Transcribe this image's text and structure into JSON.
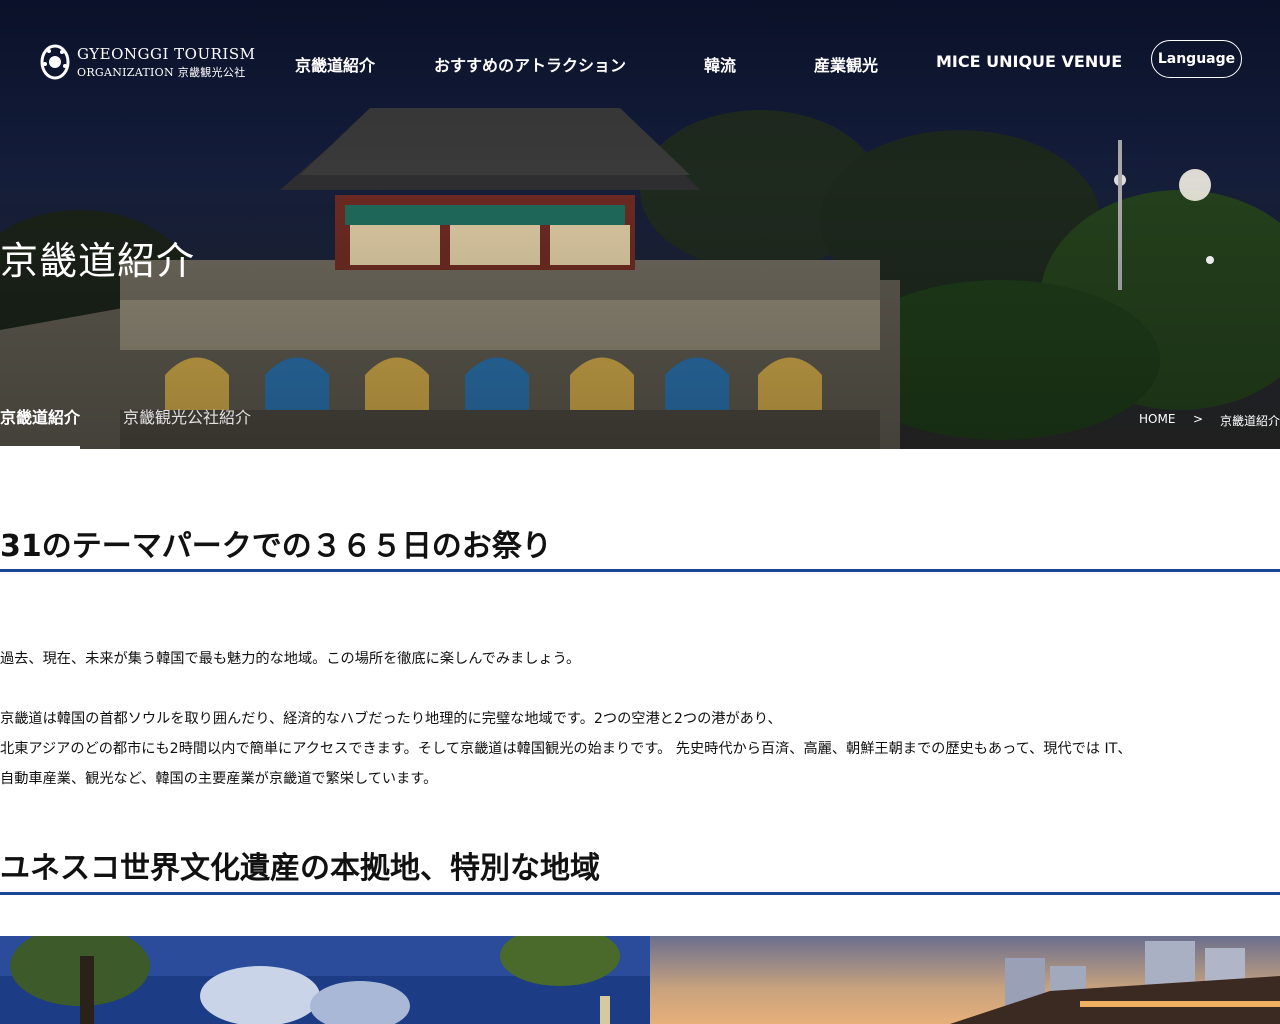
{
  "header": {
    "logo": {
      "line1": "GYEONGGI TOURISM",
      "line2": "ORGANIZATION 京畿観光公社"
    },
    "nav": [
      {
        "label": "京畿道紹介"
      },
      {
        "label": "おすすめのアトラクション"
      },
      {
        "label": "韓流"
      },
      {
        "label": "産業観光"
      },
      {
        "label": "MICE UNIQUE VENUE"
      }
    ],
    "language_button": "Language"
  },
  "hero": {
    "title": "京畿道紹介",
    "subtabs": [
      {
        "label": "京畿道紹介",
        "active": true
      },
      {
        "label": "京畿観光公社紹介",
        "active": false
      }
    ],
    "breadcrumb": {
      "home": "HOME",
      "separator": ">",
      "current": "京畿道紹介"
    }
  },
  "content": {
    "section1": {
      "title": "31のテーマパークでの３６５日のお祭り",
      "intro": "過去、現在、未来が集う韓国で最も魅力的な地域。この場所を徹底に楽しんでみましょう。",
      "body_lines": [
        "京畿道は韓国の首都ソウルを取り囲んだり、経済的なハブだったり地理的に完璧な地域です。2つの空港と2つの港があり、",
        "北東アジアのどの都市にも2時間以内で簡単にアクセスできます。そして京畿道は韓国観光の始まりです。 先史時代から百済、高麗、朝鮮王朝までの歴史もあって、現代では IT、",
        "自動車産業、観光など、韓国の主要産業が京畿道で繁栄しています。"
      ]
    },
    "section2": {
      "title": "ユネスコ世界文化遺産の本拠地、特別な地域"
    }
  },
  "colors": {
    "accent_rule": "#1c4597",
    "hero_sky": "#131c3a",
    "text": "#111111"
  }
}
